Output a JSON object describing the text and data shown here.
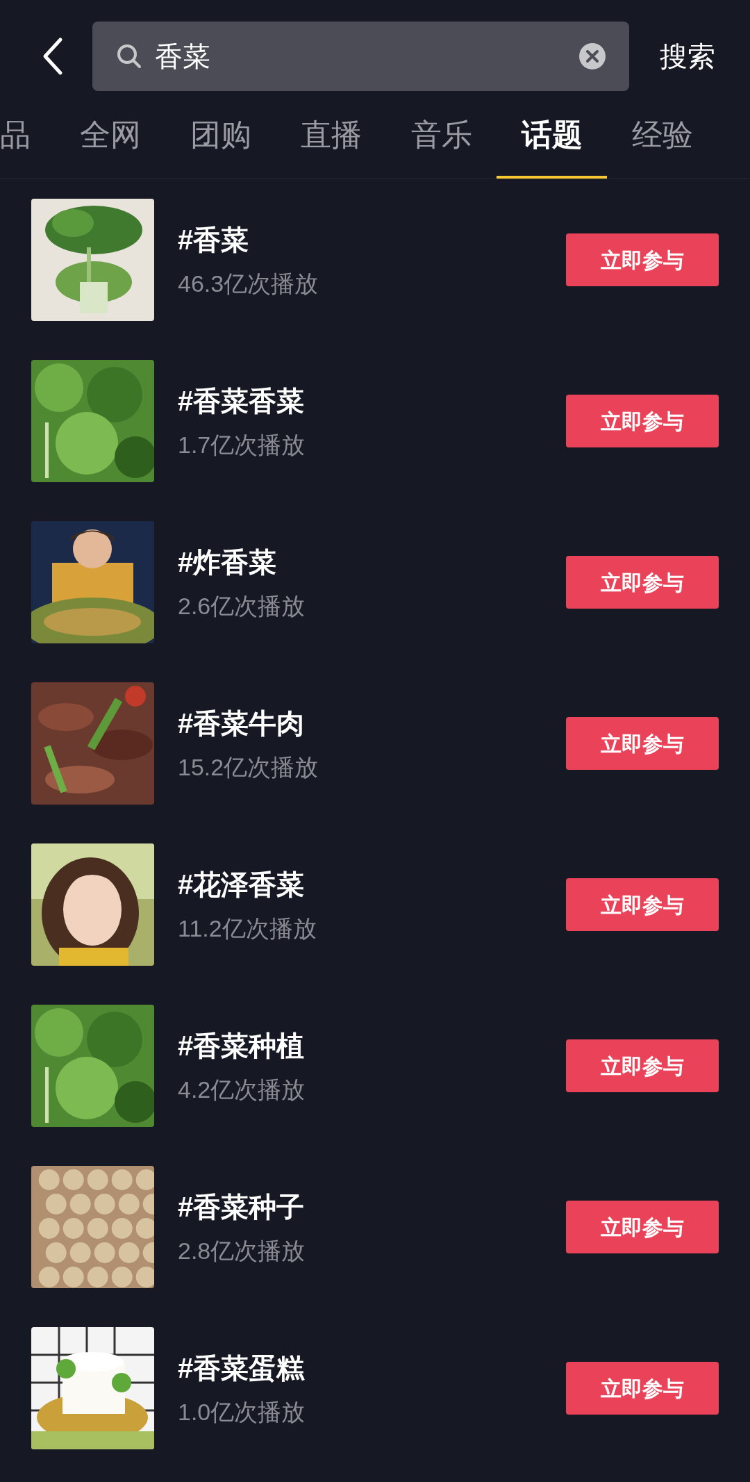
{
  "search": {
    "value": "香菜",
    "submit": "搜索"
  },
  "tabs": [
    {
      "label": "品",
      "selected": false
    },
    {
      "label": "全网",
      "selected": false
    },
    {
      "label": "团购",
      "selected": false
    },
    {
      "label": "直播",
      "selected": false
    },
    {
      "label": "音乐",
      "selected": false
    },
    {
      "label": "话题",
      "selected": true
    },
    {
      "label": "经验",
      "selected": false
    }
  ],
  "topics": [
    {
      "title": "#香菜",
      "views": "46.3亿次播放",
      "button": "立即参与"
    },
    {
      "title": "#香菜香菜",
      "views": "1.7亿次播放",
      "button": "立即参与"
    },
    {
      "title": "#炸香菜",
      "views": "2.6亿次播放",
      "button": "立即参与"
    },
    {
      "title": "#香菜牛肉",
      "views": "15.2亿次播放",
      "button": "立即参与"
    },
    {
      "title": "#花泽香菜",
      "views": "11.2亿次播放",
      "button": "立即参与"
    },
    {
      "title": "#香菜种植",
      "views": "4.2亿次播放",
      "button": "立即参与"
    },
    {
      "title": "#香菜种子",
      "views": "2.8亿次播放",
      "button": "立即参与"
    },
    {
      "title": "#香菜蛋糕",
      "views": "1.0亿次播放",
      "button": "立即参与"
    }
  ]
}
